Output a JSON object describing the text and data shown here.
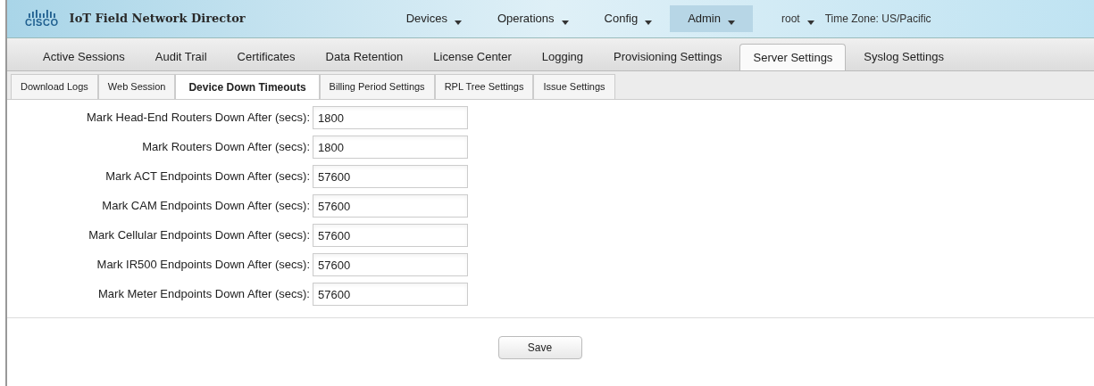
{
  "header": {
    "logo_text": "CISCO",
    "title": "IoT Field Network Director",
    "menus": [
      {
        "label": "Devices",
        "selected": false
      },
      {
        "label": "Operations",
        "selected": false
      },
      {
        "label": "Config",
        "selected": false
      },
      {
        "label": "Admin",
        "selected": true
      }
    ],
    "user": "root",
    "timezone": "Time Zone: US/Pacific"
  },
  "tabs": [
    {
      "label": "Active Sessions",
      "selected": false
    },
    {
      "label": "Audit Trail",
      "selected": false
    },
    {
      "label": "Certificates",
      "selected": false
    },
    {
      "label": "Data Retention",
      "selected": false
    },
    {
      "label": "License Center",
      "selected": false
    },
    {
      "label": "Logging",
      "selected": false
    },
    {
      "label": "Provisioning Settings",
      "selected": false
    },
    {
      "label": "Server Settings",
      "selected": true
    },
    {
      "label": "Syslog Settings",
      "selected": false
    }
  ],
  "subtabs": [
    {
      "label": "Download Logs",
      "selected": false
    },
    {
      "label": "Web Session",
      "selected": false
    },
    {
      "label": "Device Down Timeouts",
      "selected": true
    },
    {
      "label": "Billing Period Settings",
      "selected": false
    },
    {
      "label": "RPL Tree Settings",
      "selected": false
    },
    {
      "label": "Issue Settings",
      "selected": false
    }
  ],
  "fields": [
    {
      "label": "Mark Head-End Routers Down After (secs):",
      "value": "1800"
    },
    {
      "label": "Mark Routers Down After (secs):",
      "value": "1800"
    },
    {
      "label": "Mark ACT Endpoints Down After (secs):",
      "value": "57600"
    },
    {
      "label": "Mark CAM Endpoints Down After (secs):",
      "value": "57600"
    },
    {
      "label": "Mark Cellular Endpoints Down After (secs):",
      "value": "57600"
    },
    {
      "label": "Mark IR500 Endpoints Down After (secs):",
      "value": "57600"
    },
    {
      "label": "Mark Meter Endpoints Down After (secs):",
      "value": "57600"
    }
  ],
  "save_button": "Save"
}
